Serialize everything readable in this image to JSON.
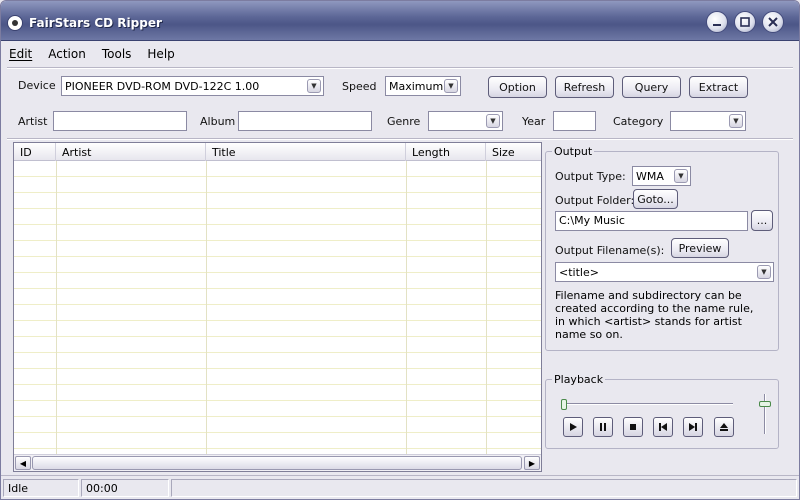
{
  "window": {
    "title": "FairStars CD Ripper"
  },
  "menu": {
    "edit": "Edit",
    "action": "Action",
    "tools": "Tools",
    "help": "Help"
  },
  "toolbar": {
    "device_label": "Device",
    "device_value": "PIONEER DVD-ROM DVD-122C 1.00",
    "speed_label": "Speed",
    "speed_value": "Maximum",
    "option_label": "Option",
    "refresh_label": "Refresh",
    "query_label": "Query",
    "extract_label": "Extract"
  },
  "meta": {
    "artist_label": "Artist",
    "artist_value": "",
    "album_label": "Album",
    "album_value": "",
    "genre_label": "Genre",
    "genre_value": "",
    "year_label": "Year",
    "year_value": "",
    "category_label": "Category",
    "category_value": ""
  },
  "table": {
    "columns": [
      "ID",
      "Artist",
      "Title",
      "Length",
      "Size"
    ],
    "rows": []
  },
  "output": {
    "group_title": "Output",
    "type_label": "Output Type:",
    "type_value": "WMA",
    "folder_label": "Output Folder:",
    "goto_label": "Goto...",
    "folder_value": "C:\\My Music",
    "browse_label": "...",
    "filename_label": "Output Filename(s):",
    "preview_label": "Preview",
    "filename_value": "<title>",
    "description": "Filename and subdirectory can be created according to the name rule, in which <artist> stands for artist name so on."
  },
  "playback": {
    "group_title": "Playback",
    "position": 0,
    "volume": 0.8
  },
  "status": {
    "state": "Idle",
    "time": "00:00"
  },
  "icons": {
    "play": "play-icon",
    "pause": "pause-icon",
    "stop": "stop-icon",
    "prev": "previous-track-icon",
    "next": "next-track-icon",
    "eject": "eject-icon"
  }
}
